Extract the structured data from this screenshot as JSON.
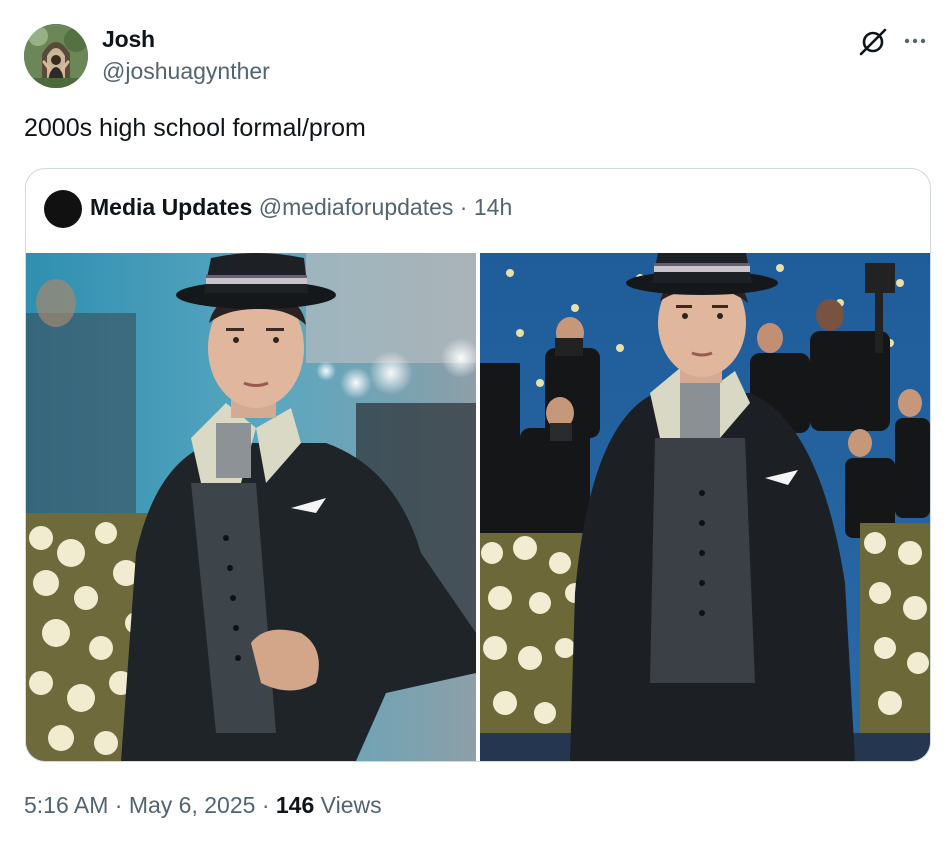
{
  "author": {
    "name": "Josh",
    "handle": "@joshuagynther"
  },
  "tweet": {
    "text": "2000s high school formal/prom"
  },
  "quoted": {
    "name": "Media Updates",
    "handle": "@mediaforupdates",
    "separator": "·",
    "time": "14h",
    "media": [
      {
        "icon": "photo-pinstripe-suit-blue-backdrop"
      },
      {
        "icon": "photo-pinstripe-suit-photographers"
      }
    ]
  },
  "footer": {
    "time": "5:16 AM",
    "sep1": "·",
    "date": "May 6, 2025",
    "sep2": "·",
    "views_count": "146",
    "views_label": "Views"
  },
  "icons": {
    "grok": "grok-icon",
    "more": "more-icon"
  },
  "colors": {
    "text": "#0f1419",
    "secondary": "#536471",
    "border": "#cfd9de",
    "background": "#ffffff"
  }
}
